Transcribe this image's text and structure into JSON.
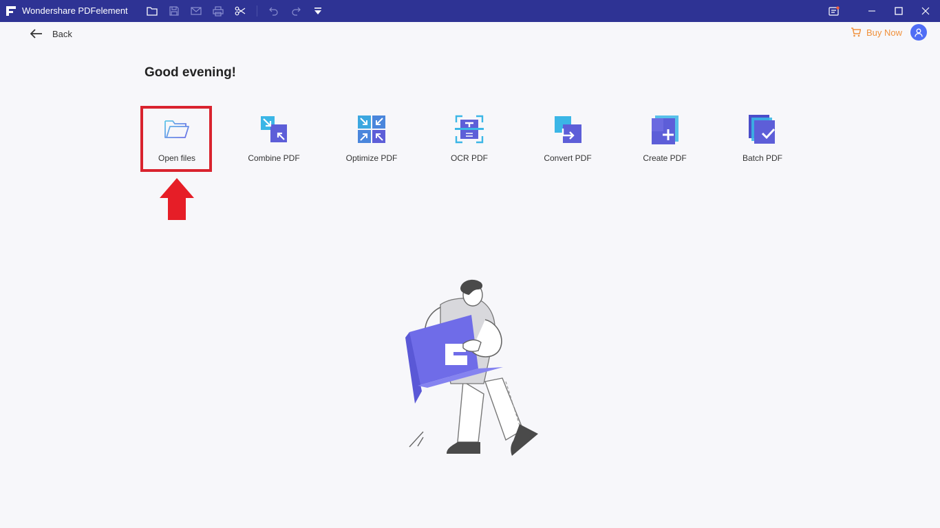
{
  "titlebar": {
    "app_title": "Wondershare PDFelement",
    "toolbar_icons": [
      "folder-icon",
      "save-icon",
      "mail-icon",
      "print-icon",
      "scissors-icon",
      "undo-icon",
      "redo-icon",
      "dropdown-icon"
    ],
    "window_controls": [
      "minimize",
      "maximize",
      "close"
    ]
  },
  "nav": {
    "back_label": "Back",
    "buy_now_label": "Buy Now"
  },
  "greeting": "Good evening!",
  "tools": [
    {
      "label": "Open files",
      "icon": "open-folder-icon"
    },
    {
      "label": "Combine PDF",
      "icon": "combine-icon"
    },
    {
      "label": "Optimize PDF",
      "icon": "optimize-icon"
    },
    {
      "label": "OCR PDF",
      "icon": "ocr-icon"
    },
    {
      "label": "Convert PDF",
      "icon": "convert-icon"
    },
    {
      "label": "Create PDF",
      "icon": "create-icon"
    },
    {
      "label": "Batch PDF",
      "icon": "batch-icon"
    }
  ],
  "colors": {
    "titlebar": "#2e3394",
    "accent": "#4f6df5",
    "buy_now": "#f0913c",
    "highlight": "#d9232e",
    "illustration_box": "#6f6ce8"
  }
}
